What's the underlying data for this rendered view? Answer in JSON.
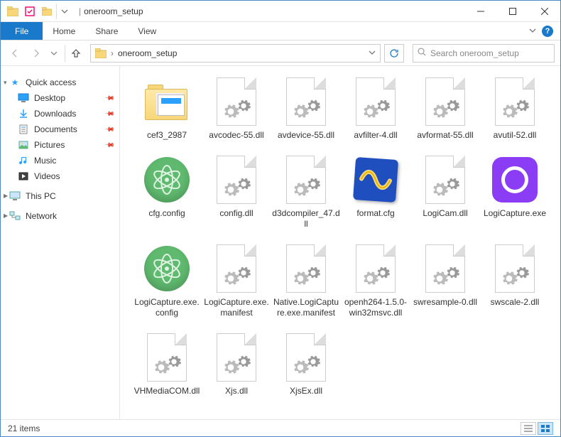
{
  "window": {
    "title": "oneroom_setup",
    "separator": "|"
  },
  "ribbon": {
    "file": "File",
    "tabs": [
      "Home",
      "Share",
      "View"
    ]
  },
  "address": {
    "crumb_root_icon": "folder",
    "crumb": "oneroom_setup",
    "search_placeholder": "Search oneroom_setup"
  },
  "sidebar": {
    "quick": {
      "label": "Quick access"
    },
    "pinned": [
      {
        "label": "Desktop",
        "icon": "desktop",
        "pinned": true
      },
      {
        "label": "Downloads",
        "icon": "downloads",
        "pinned": true
      },
      {
        "label": "Documents",
        "icon": "documents",
        "pinned": true
      },
      {
        "label": "Pictures",
        "icon": "pictures",
        "pinned": true
      },
      {
        "label": "Music",
        "icon": "music",
        "pinned": false
      },
      {
        "label": "Videos",
        "icon": "videos",
        "pinned": false
      }
    ],
    "thispc": {
      "label": "This PC"
    },
    "network": {
      "label": "Network"
    }
  },
  "files": [
    {
      "name": "cef3_2987",
      "type": "folder"
    },
    {
      "name": "avcodec-55.dll",
      "type": "dll"
    },
    {
      "name": "avdevice-55.dll",
      "type": "dll"
    },
    {
      "name": "avfilter-4.dll",
      "type": "dll"
    },
    {
      "name": "avformat-55.dll",
      "type": "dll"
    },
    {
      "name": "avutil-52.dll",
      "type": "dll"
    },
    {
      "name": "cfg.config",
      "type": "atom"
    },
    {
      "name": "config.dll",
      "type": "dll"
    },
    {
      "name": "d3dcompiler_47.dll",
      "type": "dll"
    },
    {
      "name": "format.cfg",
      "type": "format"
    },
    {
      "name": "LogiCam.dll",
      "type": "dll"
    },
    {
      "name": "LogiCapture.exe",
      "type": "logicapture"
    },
    {
      "name": "LogiCapture.exe.config",
      "type": "atom"
    },
    {
      "name": "LogiCapture.exe.manifest",
      "type": "dll"
    },
    {
      "name": "Native.LogiCapture.exe.manifest",
      "type": "dll"
    },
    {
      "name": "openh264-1.5.0-win32msvc.dll",
      "type": "dll"
    },
    {
      "name": "swresample-0.dll",
      "type": "dll"
    },
    {
      "name": "swscale-2.dll",
      "type": "dll"
    },
    {
      "name": "VHMediaCOM.dll",
      "type": "dll"
    },
    {
      "name": "Xjs.dll",
      "type": "dll"
    },
    {
      "name": "XjsEx.dll",
      "type": "dll"
    }
  ],
  "status": {
    "count_label": "21 items"
  }
}
